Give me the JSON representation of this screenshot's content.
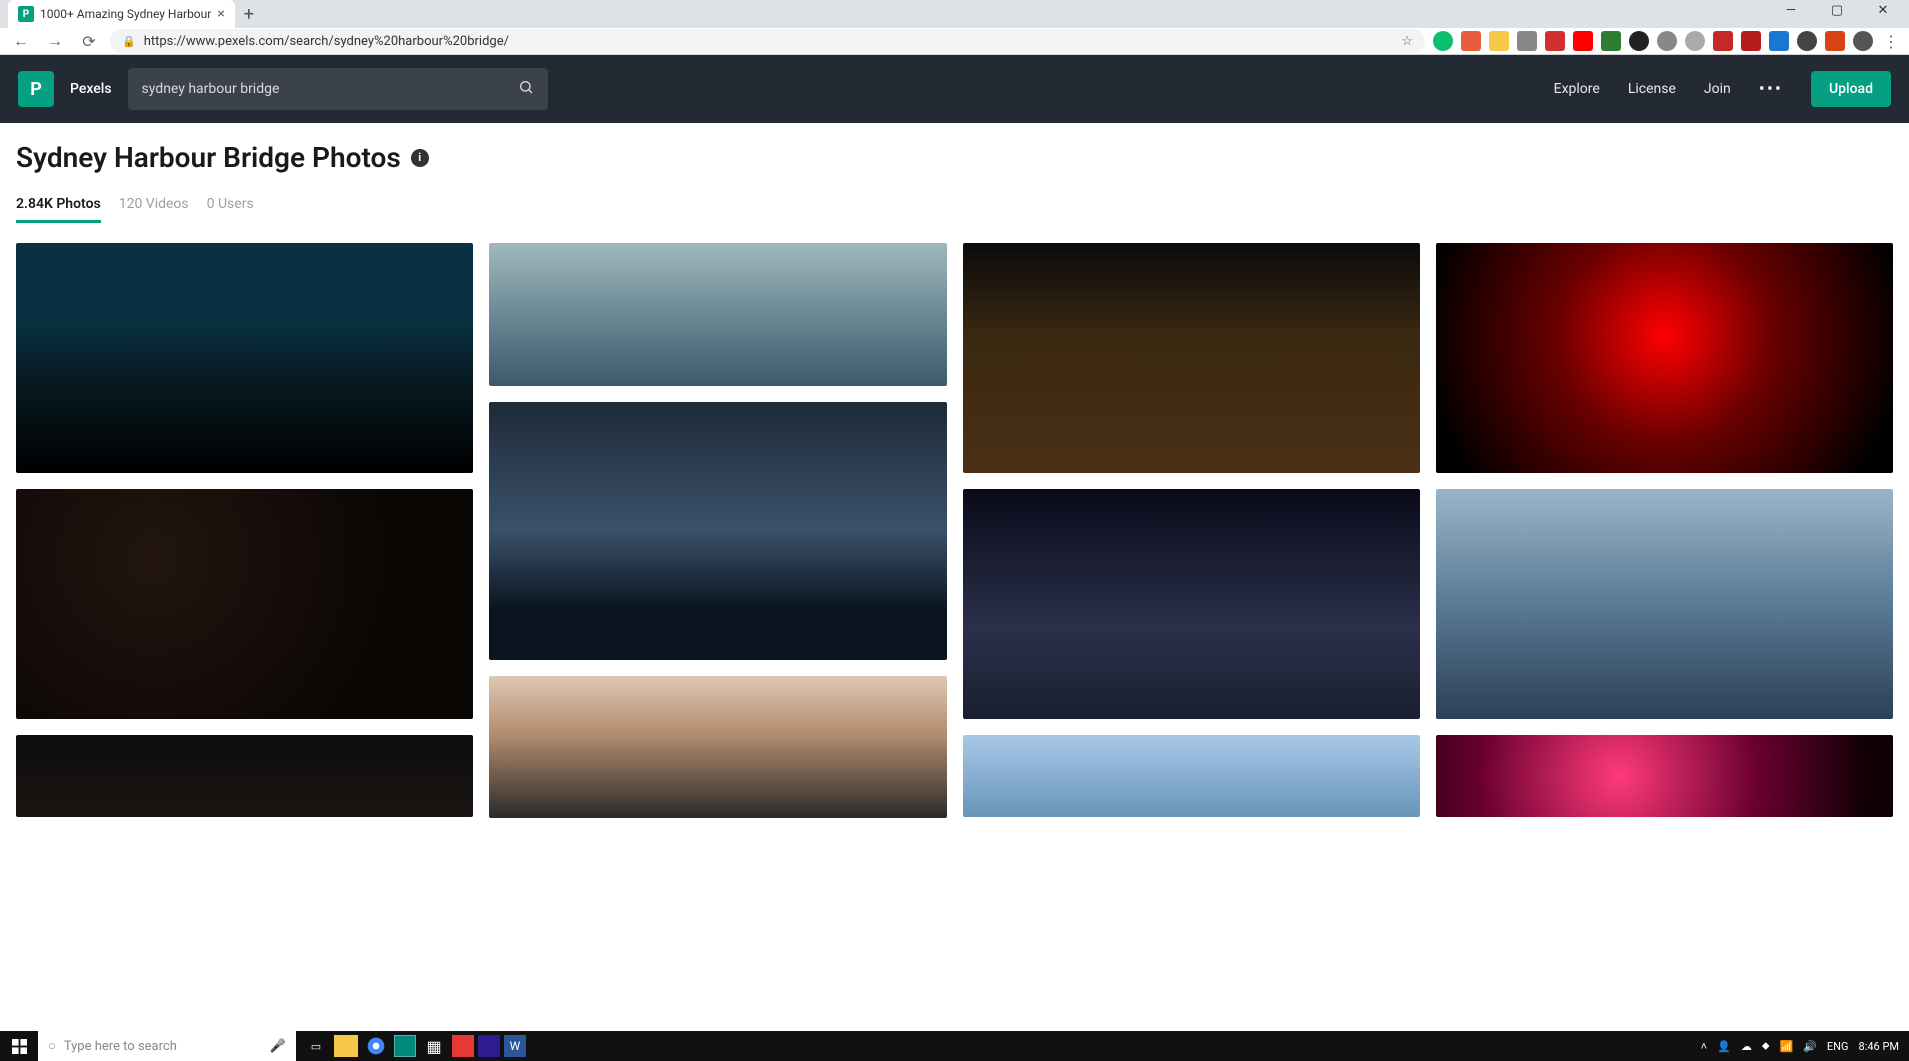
{
  "browser": {
    "tab_title": "1000+ Amazing Sydney Harbour",
    "url": "https://www.pexels.com/search/sydney%20harbour%20bridge/"
  },
  "header": {
    "brand": "Pexels",
    "search_value": "sydney harbour bridge",
    "nav": {
      "explore": "Explore",
      "license": "License",
      "join": "Join",
      "upload": "Upload"
    }
  },
  "page": {
    "title": "Sydney Harbour Bridge Photos",
    "tabs": {
      "photos": "2.84K Photos",
      "videos": "120 Videos",
      "users": "0 Users"
    }
  },
  "taskbar": {
    "search_placeholder": "Type here to search",
    "lang": "ENG",
    "time": "8:46 PM"
  }
}
